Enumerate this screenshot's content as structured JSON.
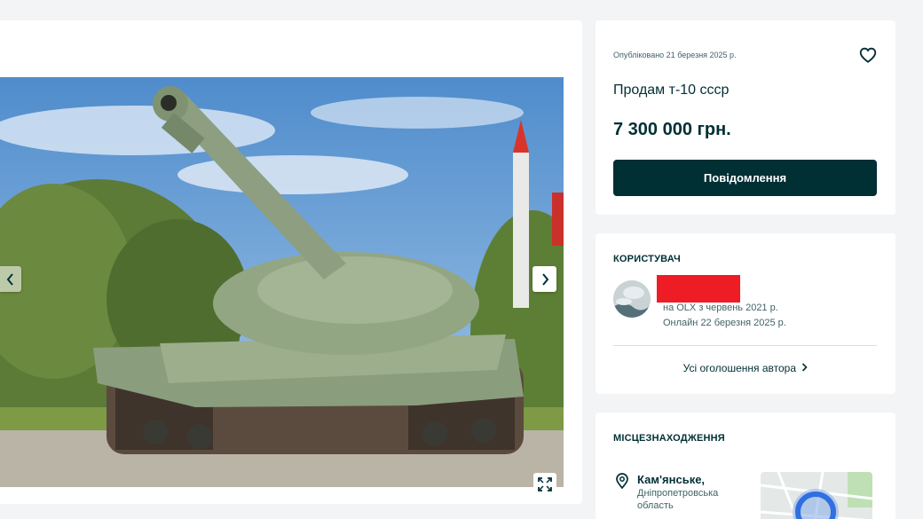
{
  "listing": {
    "published": "Опубліковано 21 березня 2025 р.",
    "title": "Продам т-10 ссср",
    "price": "7 300 000 грн.",
    "message_button": "Повідомлення"
  },
  "user": {
    "heading": "КОРИСТУВАЧ",
    "since": "на OLX з червень 2021 р.",
    "online": "Онлайн 22 березня 2025 р.",
    "all_ads_link": "Усі оголошення автора"
  },
  "location": {
    "heading": "МІСЦЕЗНАХОДЖЕННЯ",
    "city": "Кам'янське,",
    "region": "Дніпропетровська область"
  },
  "icons": {
    "favorite": "heart-icon",
    "next": "chevron-right-icon",
    "fullscreen": "expand-icon",
    "pin": "map-pin-icon"
  },
  "colors": {
    "primary": "#002f34",
    "redaction": "#ee1c25",
    "background": "#f2f4f5"
  }
}
